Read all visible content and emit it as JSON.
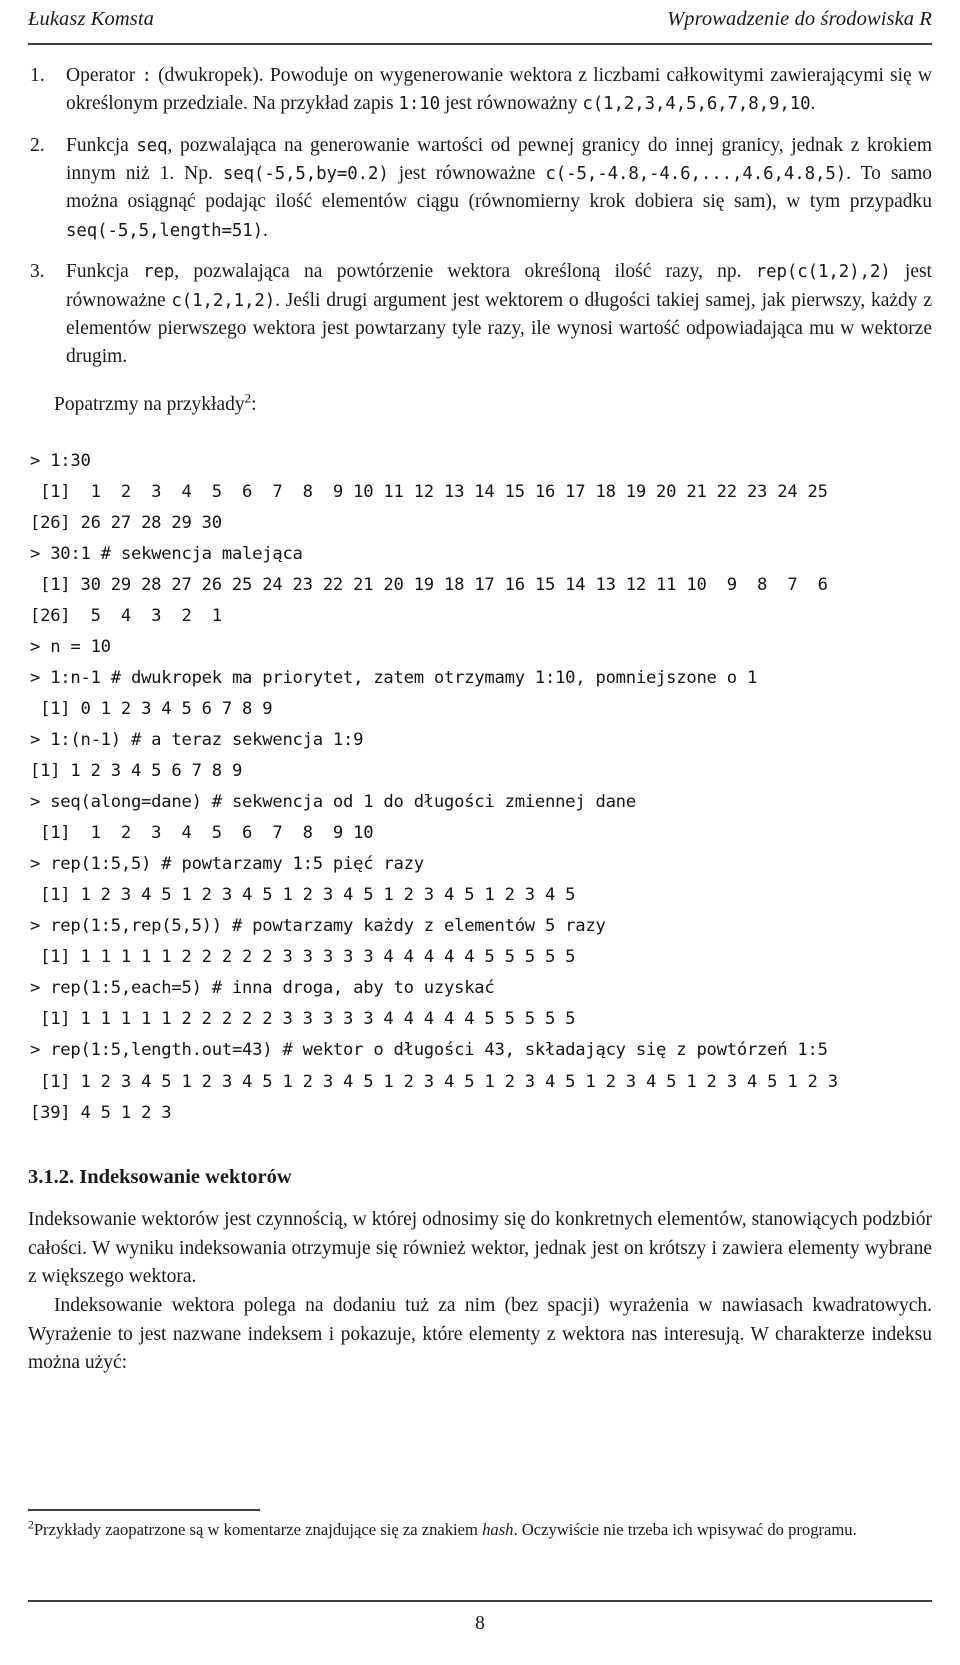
{
  "header": {
    "author": "Łukasz Komsta",
    "title": "Wprowadzenie do środowiska R"
  },
  "list": {
    "items": [
      {
        "marker": "1.",
        "segments": [
          {
            "type": "text",
            "value": "Operator "
          },
          {
            "type": "code",
            "value": ":"
          },
          {
            "type": "text",
            "value": " (dwukropek). Powoduje on wygenerowanie wektora z liczbami całkowitymi zawierającymi się w określonym przedziale. Na przykład zapis "
          },
          {
            "type": "code",
            "value": "1:10"
          },
          {
            "type": "text",
            "value": " jest równoważny "
          },
          {
            "type": "code",
            "value": "c(1,2,3,4,5,6,7,8,9,10"
          },
          {
            "type": "text",
            "value": "."
          }
        ]
      },
      {
        "marker": "2.",
        "segments": [
          {
            "type": "text",
            "value": "Funkcja "
          },
          {
            "type": "code",
            "value": "seq"
          },
          {
            "type": "text",
            "value": ", pozwalająca na generowanie wartości od pewnej granicy do innej granicy, jednak z krokiem innym niż 1. Np. "
          },
          {
            "type": "code",
            "value": "seq(-5,5,by=0.2)"
          },
          {
            "type": "text",
            "value": " jest równoważne "
          },
          {
            "type": "code",
            "value": "c(-5,-4.8,-4.6,...,4.6,4.8,5)"
          },
          {
            "type": "text",
            "value": ". To samo można osiągnąć podając ilość elementów ciągu (równomierny krok dobiera się sam), w tym przypadku "
          },
          {
            "type": "code",
            "value": "seq(-5,5,length=51)"
          },
          {
            "type": "text",
            "value": "."
          }
        ]
      },
      {
        "marker": "3.",
        "segments": [
          {
            "type": "text",
            "value": "Funkcja "
          },
          {
            "type": "code",
            "value": "rep"
          },
          {
            "type": "text",
            "value": ", pozwalająca na powtórzenie wektora określoną ilość razy, np. "
          },
          {
            "type": "code",
            "value": "rep(c(1,2),2)"
          },
          {
            "type": "text",
            "value": " jest równoważne "
          },
          {
            "type": "code",
            "value": "c(1,2,1,2)"
          },
          {
            "type": "text",
            "value": ". Jeśli drugi argument jest wektorem o długości takiej samej, jak pierwszy, każdy z elementów pierwszego wektora jest powtarzany tyle razy, ile wynosi wartość odpowiadająca mu w wektorze drugim."
          }
        ]
      }
    ]
  },
  "lead": {
    "text": "Popatrzmy na przykłady",
    "footnote_marker": "2",
    "suffix": ":"
  },
  "console": {
    "lines": [
      "> 1:30",
      " [1]  1  2  3  4  5  6  7  8  9 10 11 12 13 14 15 16 17 18 19 20 21 22 23 24 25",
      "[26] 26 27 28 29 30",
      "> 30:1 # sekwencja malejąca",
      " [1] 30 29 28 27 26 25 24 23 22 21 20 19 18 17 16 15 14 13 12 11 10  9  8  7  6",
      "[26]  5  4  3  2  1",
      "> n = 10",
      "> 1:n-1 # dwukropek ma priorytet, zatem otrzymamy 1:10, pomniejszone o 1",
      " [1] 0 1 2 3 4 5 6 7 8 9",
      "> 1:(n-1) # a teraz sekwencja 1:9",
      "[1] 1 2 3 4 5 6 7 8 9",
      "> seq(along=dane) # sekwencja od 1 do długości zmiennej dane",
      " [1]  1  2  3  4  5  6  7  8  9 10",
      "> rep(1:5,5) # powtarzamy 1:5 pięć razy",
      " [1] 1 2 3 4 5 1 2 3 4 5 1 2 3 4 5 1 2 3 4 5 1 2 3 4 5",
      "> rep(1:5,rep(5,5)) # powtarzamy każdy z elementów 5 razy",
      " [1] 1 1 1 1 1 2 2 2 2 2 3 3 3 3 3 4 4 4 4 4 5 5 5 5 5",
      "> rep(1:5,each=5) # inna droga, aby to uzyskać",
      " [1] 1 1 1 1 1 2 2 2 2 2 3 3 3 3 3 4 4 4 4 4 5 5 5 5 5",
      "> rep(1:5,length.out=43) # wektor o długości 43, składający się z powtórzeń 1:5",
      " [1] 1 2 3 4 5 1 2 3 4 5 1 2 3 4 5 1 2 3 4 5 1 2 3 4 5 1 2 3 4 5 1 2 3 4 5 1 2 3",
      "[39] 4 5 1 2 3"
    ]
  },
  "subsection": {
    "heading": "3.1.2. Indeksowanie wektorów",
    "paragraphs": [
      "Indeksowanie wektorów jest czynnością, w której odnosimy się do konkretnych elementów, stanowiących podzbiór całości. W wyniku indeksowania otrzymuje się również wektor, jednak jest on krótszy i zawiera elementy wybrane z większego wektora.",
      "Indeksowanie wektora polega na dodaniu tuż za nim (bez spacji) wyrażenia w nawiasach kwadratowych. Wyrażenie to jest nazwane indeksem i pokazuje, które elementy z wektora nas interesują. W charakterze indeksu można użyć:"
    ]
  },
  "footnote": {
    "marker": "2",
    "before_italic": "Przykłady zaopatrzone są w komentarze znajdujące się za znakiem ",
    "italic": "hash",
    "after_italic": ". Oczywiście nie trzeba ich wpisywać do programu."
  },
  "folio": "8"
}
